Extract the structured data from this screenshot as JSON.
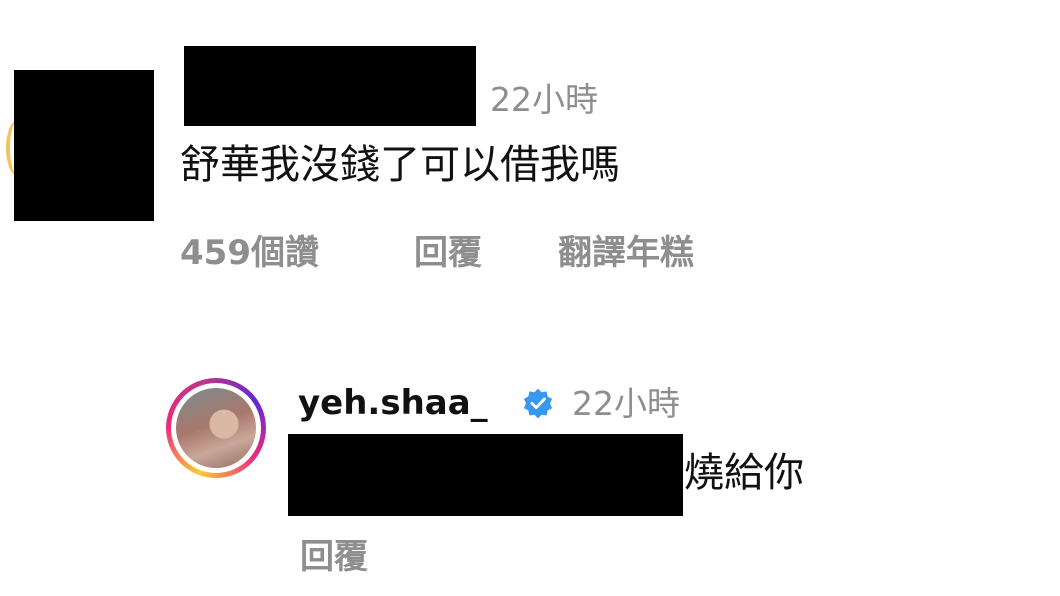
{
  "comment": {
    "time": "22小時",
    "text": "舒華我沒錢了可以借我嗎",
    "likes": "459個讚",
    "reply_label": "回覆",
    "translate_label": "翻譯年糕"
  },
  "reply": {
    "username": "yeh.shaa_",
    "time": "22小時",
    "text_visible": "燒給你",
    "reply_label": "回覆"
  },
  "colors": {
    "muted": "#8e8e8e",
    "verified": "#3897f0"
  }
}
